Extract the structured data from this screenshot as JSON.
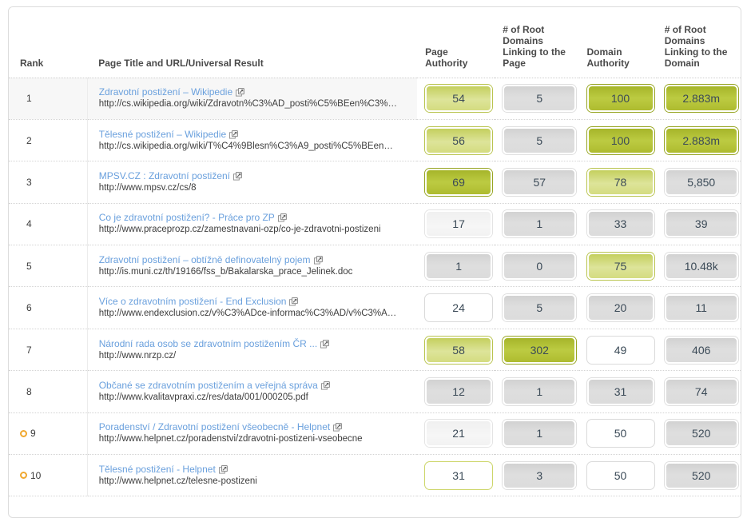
{
  "table": {
    "columns": [
      {
        "key": "rank",
        "label": "Rank"
      },
      {
        "key": "title",
        "label": "Page Title and URL/Universal Result"
      },
      {
        "key": "pa",
        "label_lines": [
          "Page",
          "Authority"
        ]
      },
      {
        "key": "rdp",
        "label_lines": [
          "# of Root",
          "Domains",
          "Linking to the",
          "Page"
        ]
      },
      {
        "key": "da",
        "label_lines": [
          "Domain",
          "Authority"
        ]
      },
      {
        "key": "rdd",
        "label_lines": [
          "# of Root",
          "Domains",
          "Linking to the",
          "Domain"
        ]
      }
    ],
    "rows": [
      {
        "rank": "1",
        "marker": false,
        "shaded": true,
        "title": "Zdravotní postižení – Wikipedie",
        "url": "http://cs.wikipedia.org/wiki/Zdravotn%C3%AD_posti%C5%BEen%C3%…",
        "page_authority": {
          "value": "54",
          "style": "green-light"
        },
        "root_domains_page": {
          "value": "5",
          "style": "gray"
        },
        "domain_authority": {
          "value": "100",
          "style": "green"
        },
        "root_domains_domain": {
          "value": "2.883m",
          "style": "green"
        }
      },
      {
        "rank": "2",
        "marker": false,
        "shaded": false,
        "title": "Tělesné postižení – Wikipedie",
        "url": "http://cs.wikipedia.org/wiki/T%C4%9Blesn%C3%A9_posti%C5%BEen…",
        "page_authority": {
          "value": "56",
          "style": "green-light"
        },
        "root_domains_page": {
          "value": "5",
          "style": "gray"
        },
        "domain_authority": {
          "value": "100",
          "style": "green"
        },
        "root_domains_domain": {
          "value": "2.883m",
          "style": "green"
        }
      },
      {
        "rank": "3",
        "marker": false,
        "shaded": false,
        "title": "MPSV.CZ : Zdravotní postižení",
        "url": "http://www.mpsv.cz/cs/8",
        "page_authority": {
          "value": "69",
          "style": "green"
        },
        "root_domains_page": {
          "value": "57",
          "style": "gray"
        },
        "domain_authority": {
          "value": "78",
          "style": "green-light"
        },
        "root_domains_domain": {
          "value": "5,850",
          "style": "gray"
        }
      },
      {
        "rank": "4",
        "marker": false,
        "shaded": false,
        "title": "Co je zdravotní postižení? - Práce pro ZP",
        "url": "http://www.praceprozp.cz/zamestnavani-ozp/co-je-zdravotni-postizeni",
        "page_authority": {
          "value": "17",
          "style": "gray-light"
        },
        "root_domains_page": {
          "value": "1",
          "style": "gray"
        },
        "domain_authority": {
          "value": "33",
          "style": "gray"
        },
        "root_domains_domain": {
          "value": "39",
          "style": "gray"
        }
      },
      {
        "rank": "5",
        "marker": false,
        "shaded": false,
        "title": "Zdravotní postižení – obtížně definovatelný pojem",
        "url": "http://is.muni.cz/th/19166/fss_b/Bakalarska_prace_Jelinek.doc",
        "page_authority": {
          "value": "1",
          "style": "gray"
        },
        "root_domains_page": {
          "value": "0",
          "style": "gray"
        },
        "domain_authority": {
          "value": "75",
          "style": "green-light"
        },
        "root_domains_domain": {
          "value": "10.48k",
          "style": "gray"
        }
      },
      {
        "rank": "6",
        "marker": false,
        "shaded": false,
        "title": "Více o zdravotním postižení - End Exclusion",
        "url": "http://www.endexclusion.cz/v%C3%ADce-informac%C3%AD/v%C3%A…",
        "page_authority": {
          "value": "24",
          "style": "white"
        },
        "root_domains_page": {
          "value": "5",
          "style": "gray"
        },
        "domain_authority": {
          "value": "20",
          "style": "gray"
        },
        "root_domains_domain": {
          "value": "11",
          "style": "gray"
        }
      },
      {
        "rank": "7",
        "marker": false,
        "shaded": false,
        "title": "Národní rada osob se zdravotním postižením ČR ...",
        "url": "http://www.nrzp.cz/",
        "page_authority": {
          "value": "58",
          "style": "green-light"
        },
        "root_domains_page": {
          "value": "302",
          "style": "green"
        },
        "domain_authority": {
          "value": "49",
          "style": "white"
        },
        "root_domains_domain": {
          "value": "406",
          "style": "gray"
        }
      },
      {
        "rank": "8",
        "marker": false,
        "shaded": false,
        "title": "Občané se zdravotním postižením a veřejná správa",
        "url": "http://www.kvalitavpraxi.cz/res/data/001/000205.pdf",
        "page_authority": {
          "value": "12",
          "style": "gray"
        },
        "root_domains_page": {
          "value": "1",
          "style": "gray"
        },
        "domain_authority": {
          "value": "31",
          "style": "gray"
        },
        "root_domains_domain": {
          "value": "74",
          "style": "gray"
        }
      },
      {
        "rank": "9",
        "marker": true,
        "shaded": false,
        "title": "Poradenství / Zdravotní postižení všeobecně - Helpnet",
        "url": "http://www.helpnet.cz/poradenstvi/zdravotni-postizeni-vseobecne",
        "page_authority": {
          "value": "21",
          "style": "gray-light"
        },
        "root_domains_page": {
          "value": "1",
          "style": "gray"
        },
        "domain_authority": {
          "value": "50",
          "style": "white"
        },
        "root_domains_domain": {
          "value": "520",
          "style": "gray"
        }
      },
      {
        "rank": "10",
        "marker": true,
        "shaded": false,
        "title": "Tělesné postižení - Helpnet",
        "url": "http://www.helpnet.cz/telesne-postizeni",
        "page_authority": {
          "value": "31",
          "style": "white-green"
        },
        "root_domains_page": {
          "value": "3",
          "style": "gray"
        },
        "domain_authority": {
          "value": "50",
          "style": "white"
        },
        "root_domains_domain": {
          "value": "520",
          "style": "gray"
        }
      }
    ]
  },
  "icons": {
    "external_link": "external-link-icon",
    "rank_marker": "universal-result-marker-icon"
  },
  "colors": {
    "link": "#6aa0dd",
    "marker": "#f0a830",
    "badge_green": "#aebb2f",
    "badge_green_light": "#d4dc80",
    "badge_gray": "#dcdcdc"
  }
}
